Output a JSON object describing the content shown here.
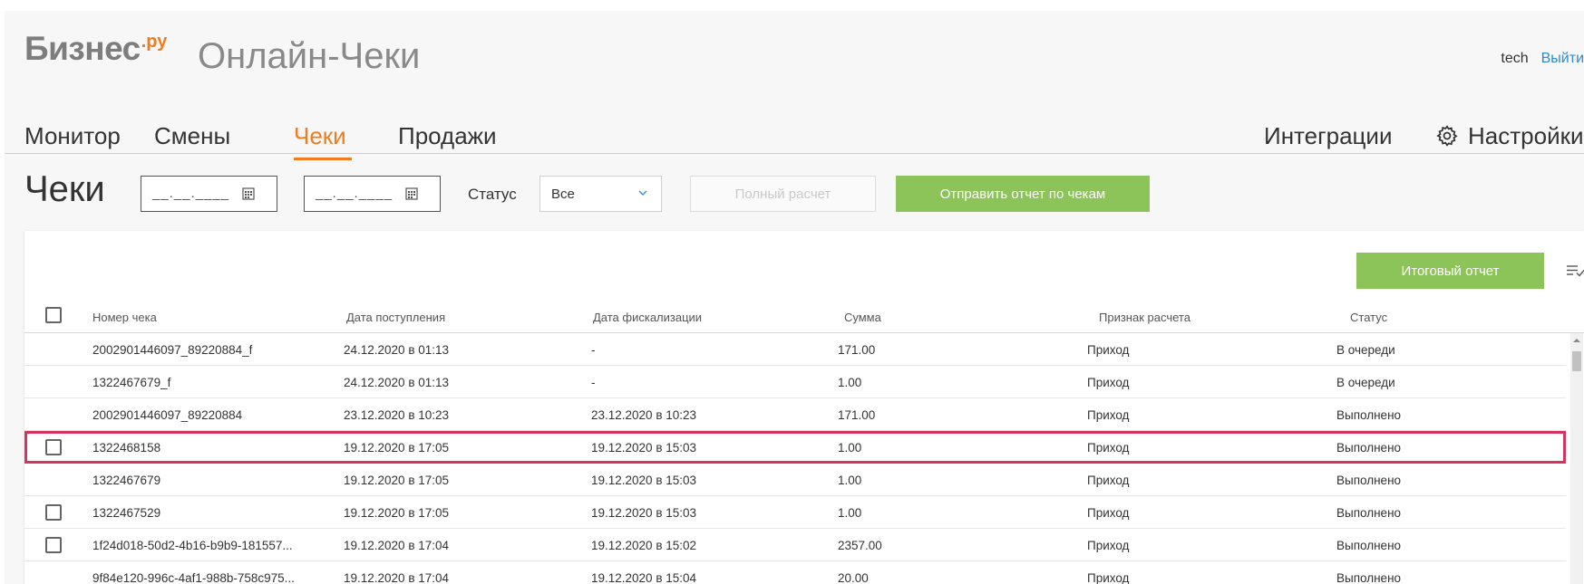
{
  "header": {
    "brand": "Бизнес",
    "brand_suffix": ".ру",
    "product": "Онлайн-Чеки",
    "user": "tech",
    "logout": "Выйти"
  },
  "nav": {
    "items": [
      {
        "label": "Монитор"
      },
      {
        "label": "Смены"
      },
      {
        "label": "Чеки",
        "active": true
      },
      {
        "label": "Продажи"
      }
    ],
    "integrations": "Интеграции",
    "settings": "Настройки"
  },
  "filters": {
    "title": "Чеки",
    "date_from_placeholder": "__.__.____",
    "date_to_placeholder": "__.__.____",
    "status_label": "Статус",
    "status_value": "Все",
    "full_calc_button": "Полный расчет",
    "send_report_button": "Отправить отчет по чекам"
  },
  "table": {
    "summary_button": "Итоговый отчет",
    "columns": [
      "Номер чека",
      "Дата поступления",
      "Дата фискализации",
      "Сумма",
      "Признак расчета",
      "Статус"
    ],
    "rows": [
      {
        "checkbox": false,
        "cells": [
          "2002901446097_89220884_f",
          "24.12.2020 в 01:13",
          "-",
          "171.00",
          "Приход",
          "В очереди"
        ]
      },
      {
        "checkbox": false,
        "cells": [
          "1322467679_f",
          "24.12.2020 в 01:13",
          "-",
          "1.00",
          "Приход",
          "В очереди"
        ]
      },
      {
        "checkbox": false,
        "cells": [
          "2002901446097_89220884",
          "23.12.2020 в 10:23",
          "23.12.2020 в 10:23",
          "171.00",
          "Приход",
          "Выполнено"
        ]
      },
      {
        "checkbox": true,
        "highlight": true,
        "cells": [
          "1322468158",
          "19.12.2020 в 17:05",
          "19.12.2020 в 15:03",
          "1.00",
          "Приход",
          "Выполнено"
        ]
      },
      {
        "checkbox": false,
        "cells": [
          "1322467679",
          "19.12.2020 в 17:05",
          "19.12.2020 в 15:03",
          "1.00",
          "Приход",
          "Выполнено"
        ]
      },
      {
        "checkbox": true,
        "cells": [
          "1322467529",
          "19.12.2020 в 17:05",
          "19.12.2020 в 15:03",
          "1.00",
          "Приход",
          "Выполнено"
        ]
      },
      {
        "checkbox": true,
        "cells": [
          "1f24d018-50d2-4b16-b9b9-181557...",
          "19.12.2020 в 17:04",
          "19.12.2020 в 15:02",
          "2357.00",
          "Приход",
          "Выполнено"
        ]
      },
      {
        "checkbox": false,
        "cells": [
          "9f84e120-996c-4af1-988b-758c975...",
          "19.12.2020 в 17:04",
          "19.12.2020 в 15:04",
          "20.00",
          "Приход",
          "Выполнено"
        ]
      }
    ]
  },
  "colors": {
    "accent": "#f07c1f",
    "green": "#8dc459",
    "link": "#2b8ad8",
    "highlight": "#d6345e"
  },
  "icons": [
    "gear-icon",
    "calendar-icon",
    "chevron-down-icon",
    "sort-icon",
    "scroll-up-icon"
  ]
}
